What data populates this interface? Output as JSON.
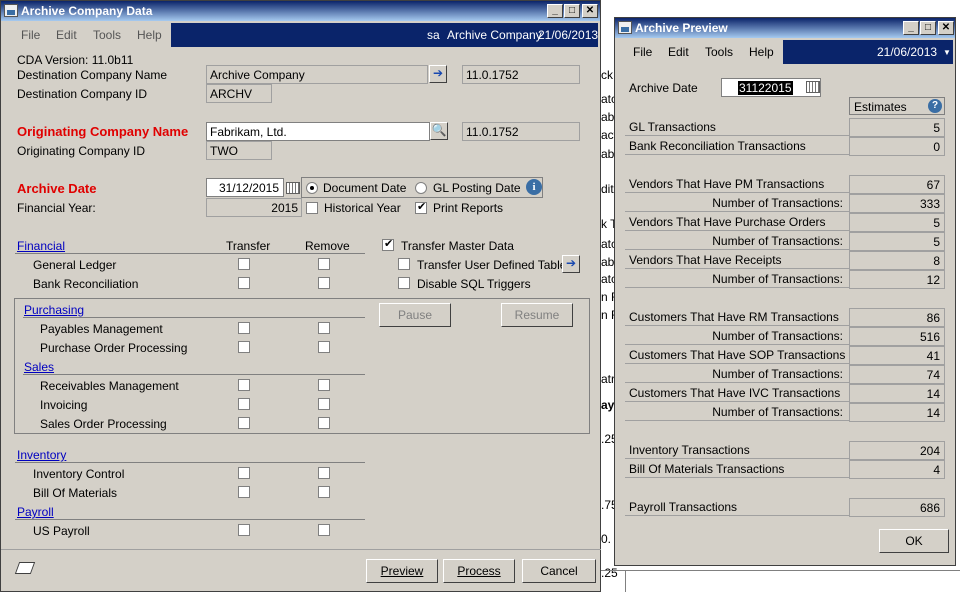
{
  "main_window": {
    "title": "Archive Company Data",
    "menu": [
      "File",
      "Edit",
      "Tools",
      "Help"
    ],
    "status": {
      "user": "sa",
      "company": "Archive Company",
      "date": "21/06/2013"
    },
    "version_text": "CDA Version: 11.0b11",
    "dest_company_name_label": "Destination Company Name",
    "dest_company_name_value": "Archive Company",
    "dest_company_version": "11.0.1752",
    "dest_company_id_label": "Destination Company ID",
    "dest_company_id_value": "ARCHV",
    "orig_company_name_label": "Originating Company Name",
    "orig_company_name_value": "Fabrikam, Ltd.",
    "orig_company_version": "11.0.1752",
    "orig_company_id_label": "Originating Company ID",
    "orig_company_id_value": "TWO",
    "archive_date_label": "Archive Date",
    "archive_date_value": "31/12/2015",
    "document_date_label": "Document Date",
    "gl_posting_date_label": "GL Posting Date",
    "financial_year_label": "Financial Year:",
    "financial_year_value": "2015",
    "historical_year_label": "Historical Year",
    "print_reports_label": "Print Reports",
    "col_transfer": "Transfer",
    "col_remove": "Remove",
    "financial_link": "Financial",
    "general_ledger": "General Ledger",
    "bank_reconciliation": "Bank Reconciliation",
    "purchasing_link": "Purchasing",
    "payables_management": "Payables Management",
    "purchase_order_processing": "Purchase Order Processing",
    "sales_link": "Sales",
    "receivables_management": "Receivables Management",
    "invoicing": "Invoicing",
    "sales_order_processing": "Sales Order Processing",
    "inventory_link": "Inventory",
    "inventory_control": "Inventory Control",
    "bill_of_materials": "Bill Of Materials",
    "payroll_link": "Payroll",
    "us_payroll": "US Payroll",
    "transfer_master_data": "Transfer Master Data",
    "transfer_user_defined_tables": "Transfer User Defined Tables",
    "disable_sql_triggers": "Disable SQL Triggers",
    "pause": "Pause",
    "resume": "Resume",
    "preview": "Preview",
    "process": "Process",
    "cancel": "Cancel"
  },
  "preview_window": {
    "title": "Archive Preview",
    "menu": [
      "File",
      "Edit",
      "Tools",
      "Help"
    ],
    "date": "21/06/2013",
    "archive_date_label": "Archive Date",
    "archive_date_value": "31122015",
    "estimates_header": "Estimates",
    "rows": [
      {
        "label": "GL Transactions",
        "value": "5"
      },
      {
        "label": "Bank Reconciliation Transactions",
        "value": "0"
      },
      {
        "label": "Vendors That Have PM Transactions",
        "value": "67"
      },
      {
        "label": "Number of Transactions:",
        "value": "333"
      },
      {
        "label": "Vendors That Have Purchase Orders",
        "value": "5"
      },
      {
        "label": "Number of Transactions:",
        "value": "5"
      },
      {
        "label": "Vendors That Have Receipts",
        "value": "8"
      },
      {
        "label": "Number of Transactions:",
        "value": "12"
      },
      {
        "label": "Customers That Have RM Transactions",
        "value": "86"
      },
      {
        "label": "Number of Transactions:",
        "value": "516"
      },
      {
        "label": "Customers That Have SOP Transactions",
        "value": "41"
      },
      {
        "label": "Number of Transactions:",
        "value": "74"
      },
      {
        "label": "Customers That Have IVC Transactions",
        "value": "14"
      },
      {
        "label": "Number of Transactions:",
        "value": "14"
      },
      {
        "label": "Inventory Transactions",
        "value": "204"
      },
      {
        "label": "Bill Of Materials Transactions",
        "value": "4"
      },
      {
        "label": "Payroll Transactions",
        "value": "686"
      }
    ],
    "ok": "OK"
  },
  "background_fragments": [
    "ck",
    "atc",
    "ab",
    "act",
    "ab",
    "dit",
    "k T",
    "atc",
    "ab",
    "atc",
    "n F",
    "n F",
    "atri",
    "ay",
    ".25",
    ".75",
    "0.",
    ".25"
  ]
}
